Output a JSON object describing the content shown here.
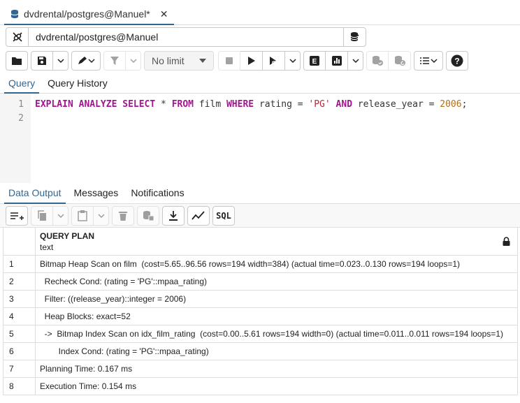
{
  "tab": {
    "title": "dvdrental/postgres@Manuel*"
  },
  "connection": {
    "label": "dvdrental/postgres@Manuel"
  },
  "toolbar": {
    "limit_label": "No limit"
  },
  "query_tabs": [
    "Query",
    "Query History"
  ],
  "editor": {
    "line_numbers": [
      "1",
      "2"
    ],
    "tokens": [
      {
        "t": "EXPLAIN",
        "k": "kw"
      },
      {
        "t": " ",
        "k": ""
      },
      {
        "t": "ANALYZE",
        "k": "kw"
      },
      {
        "t": " ",
        "k": ""
      },
      {
        "t": "SELECT",
        "k": "kw"
      },
      {
        "t": " * ",
        "k": ""
      },
      {
        "t": "FROM",
        "k": "kw"
      },
      {
        "t": " film ",
        "k": ""
      },
      {
        "t": "WHERE",
        "k": "kw"
      },
      {
        "t": " rating = ",
        "k": ""
      },
      {
        "t": "'PG'",
        "k": "str"
      },
      {
        "t": " ",
        "k": ""
      },
      {
        "t": "AND",
        "k": "kw"
      },
      {
        "t": " release_year = ",
        "k": ""
      },
      {
        "t": "2006",
        "k": "num"
      },
      {
        "t": ";",
        "k": ""
      }
    ]
  },
  "output_tabs": [
    "Data Output",
    "Messages",
    "Notifications"
  ],
  "output_toolbar": {
    "sql_label": "SQL"
  },
  "grid": {
    "column_name": "QUERY PLAN",
    "column_type": "text",
    "rows": [
      {
        "n": "1",
        "text": "Bitmap Heap Scan on film  (cost=5.65..96.56 rows=194 width=384) (actual time=0.023..0.130 rows=194 loops=1)"
      },
      {
        "n": "2",
        "text": "  Recheck Cond: (rating = 'PG'::mpaa_rating)"
      },
      {
        "n": "3",
        "text": "  Filter: ((release_year)::integer = 2006)"
      },
      {
        "n": "4",
        "text": "  Heap Blocks: exact=52"
      },
      {
        "n": "5",
        "text": "  ->  Bitmap Index Scan on idx_film_rating  (cost=0.00..5.61 rows=194 width=0) (actual time=0.011..0.011 rows=194 loops=1)"
      },
      {
        "n": "6",
        "text": "        Index Cond: (rating = 'PG'::mpaa_rating)"
      },
      {
        "n": "7",
        "text": "Planning Time: 0.167 ms"
      },
      {
        "n": "8",
        "text": "Execution Time: 0.154 ms"
      }
    ]
  }
}
